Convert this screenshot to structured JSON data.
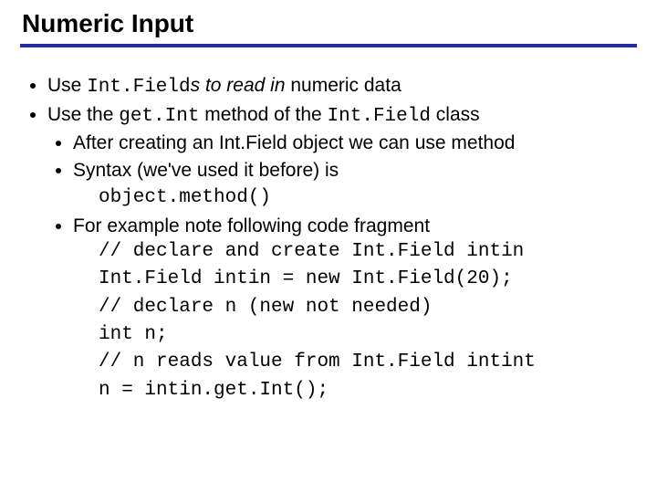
{
  "title": "Numeric Input",
  "b1": {
    "pre": "Use ",
    "code": "Int.Field",
    "mid_italic": "s to read in",
    "post": " numeric data"
  },
  "b2": {
    "t1": "Use the ",
    "c1": "get.Int",
    "t2": " method of the ",
    "c2": "Int.Field",
    "t3": " class"
  },
  "b3": "After creating an Int.Field object we can use method",
  "b4": {
    "line": "Syntax (we've used it before) is",
    "code": "object.method()"
  },
  "b5": "For example note following code fragment",
  "code": {
    "l1": "// declare and create Int.Field intin",
    "l2": "Int.Field intin = new Int.Field(20);",
    "l3": "// declare n (new not needed)",
    "l4": "int n;",
    "l5": "// n reads value from Int.Field intint",
    "l6": "n = intin.get.Int();"
  }
}
